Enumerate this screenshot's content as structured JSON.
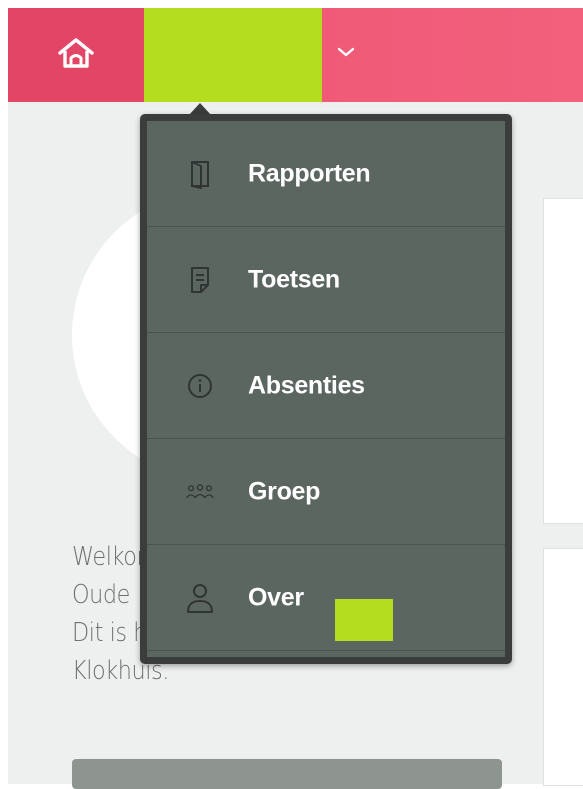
{
  "app": {
    "accent_color": "#f05b78",
    "highlight_color": "#b4dd1f"
  },
  "header": {
    "home_icon": "home-icon",
    "child_selector_value": "",
    "dropdown_icon": "chevron-down-icon"
  },
  "menu": {
    "items": [
      {
        "label": "Rapporten",
        "icon": "report-book-icon"
      },
      {
        "label": "Toetsen",
        "icon": "test-document-icon"
      },
      {
        "label": "Absenties",
        "icon": "info-circle-icon"
      },
      {
        "label": "Groep",
        "icon": "group-people-icon"
      },
      {
        "label": "Over",
        "icon": "person-icon"
      }
    ]
  },
  "welcome": {
    "lines": [
      "Welkom",
      "Oude",
      "Dit is het fotoboek van",
      "Klokhuis."
    ]
  }
}
